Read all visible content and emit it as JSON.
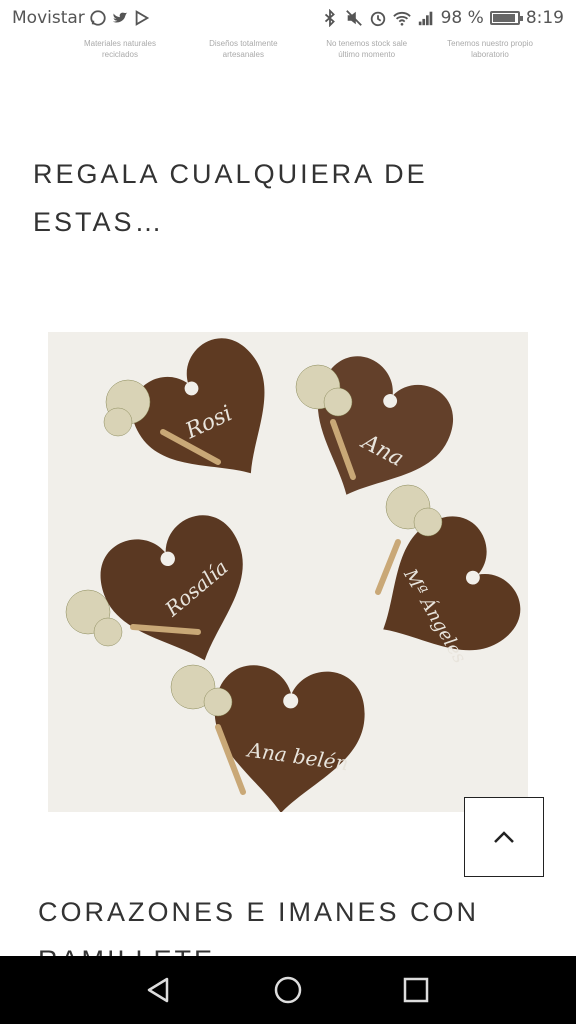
{
  "status_bar": {
    "carrier": "Movistar",
    "battery_percent": "98 %",
    "battery_level": 0.98,
    "time": "8:19"
  },
  "features": [
    "Materiales naturales reciclados",
    "Diseños totalmente artesanales",
    "No tenemos stock sale último momento",
    "Tenemos nuestro propio laboratorio"
  ],
  "section1": {
    "heading": "REGALA CUALQUIERA DE ESTAS…"
  },
  "photo": {
    "names": [
      "Rosi",
      "Ana",
      "Rosalía",
      "Mª Ángeles",
      "Ana belén"
    ]
  },
  "section2": {
    "heading": "CORAZONES E IMANES CON RAMILLETE"
  },
  "colors": {
    "heading": "#333333",
    "heart_wood": "#5e3a22",
    "navbar": "#000000"
  },
  "icons": {
    "back_to_top": "chevron-up-icon",
    "nav_back": "triangle-back-icon",
    "nav_home": "circle-home-icon",
    "nav_recents": "square-recents-icon"
  }
}
